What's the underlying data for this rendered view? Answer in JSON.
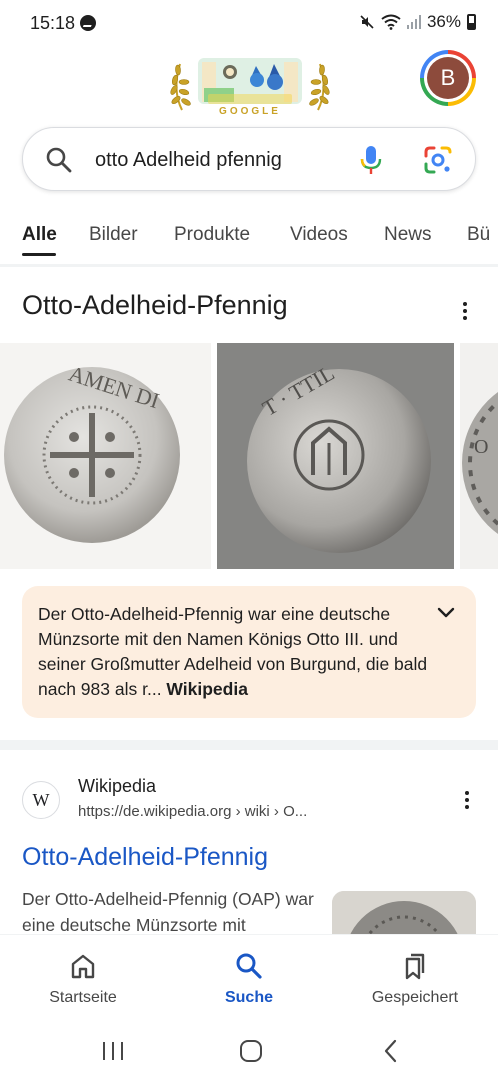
{
  "status_bar": {
    "time": "15:18",
    "battery": "36%"
  },
  "header": {
    "doodle_label": "GOOGLE",
    "avatar_letter": "B"
  },
  "search": {
    "query": "otto Adelheid pfennig"
  },
  "tabs": [
    {
      "label": "Alle",
      "active": true
    },
    {
      "label": "Bilder"
    },
    {
      "label": "Produkte"
    },
    {
      "label": "Videos"
    },
    {
      "label": "News"
    },
    {
      "label": "Bü"
    }
  ],
  "knowledge_panel": {
    "title": "Otto-Adelheid-Pfennig",
    "description": "Der Otto-Adelheid-Pfennig war eine deutsche Münzsorte mit den Namen Königs Otto III. und seiner Großmutter Adelheid von Burgund, die bald nach 983 als r",
    "source": "Wikipedia"
  },
  "result": {
    "site_name": "Wikipedia",
    "url": "https://de.wikipedia.org › wiki › O...",
    "title": "Otto-Adelheid-Pfennig",
    "snippet": "Der Otto-Adelheid-Pfennig (OAP) war eine deutsche Münzsorte mit"
  },
  "bottom_nav": [
    {
      "label": "Startseite",
      "icon": "home-icon"
    },
    {
      "label": "Suche",
      "icon": "search-icon",
      "active": true
    },
    {
      "label": "Gespeichert",
      "icon": "bookmarks-icon"
    }
  ],
  "colors": {
    "link_blue": "#1a57c5",
    "description_bg": "#fdeee0",
    "avatar_bg": "#8d4b3c"
  }
}
